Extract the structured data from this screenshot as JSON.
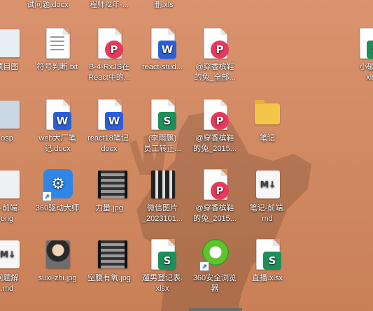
{
  "desktop": {
    "row0": [
      {
        "label": "试问题.docx"
      },
      {
        "label": "程师-2年-..."
      },
      {
        "label": "删.xls"
      }
    ],
    "row1": [
      {
        "label": "项目图"
      },
      {
        "label": "符号判断.txt"
      },
      {
        "label": "B-4-RxJS在\nReact中的..."
      },
      {
        "label": "react-stud..."
      },
      {
        "label": "@穿香槟鞋\n的兔_全部..."
      },
      {
        "label": "小破书\nxls"
      }
    ],
    "row2": [
      {
        "label": "osp"
      },
      {
        "label": "web大厂笔\n记.docx"
      },
      {
        "label": "react18笔记.\ndocx"
      },
      {
        "label": "(李雨飘)\n员工转正..."
      },
      {
        "label": "@穿香槟鞋\n的兔_2015..."
      },
      {
        "label": "笔记"
      }
    ],
    "row3": [
      {
        "label": "P-前端.\nong"
      },
      {
        "label": "360驱动大师"
      },
      {
        "label": "力量.jpg"
      },
      {
        "label": "微信图片\n_2023101..."
      },
      {
        "label": "@穿香槟鞋\n的兔_2015..."
      },
      {
        "label": "笔记-前端.\nmd"
      }
    ],
    "row4": [
      {
        "label": "问题解\n.md"
      },
      {
        "label": "suxi-zhi.jpg"
      },
      {
        "label": "空腹有氧.jpg"
      },
      {
        "label": "遛男登记表.\nxlsx"
      },
      {
        "label": "360安全浏览\n器"
      },
      {
        "label": "直播.xlsx"
      }
    ],
    "badges": {
      "word": "W",
      "sheet": "S",
      "pdf": "P",
      "md": "M↓",
      "driver": "⚙",
      "shortcut": "↗"
    }
  }
}
